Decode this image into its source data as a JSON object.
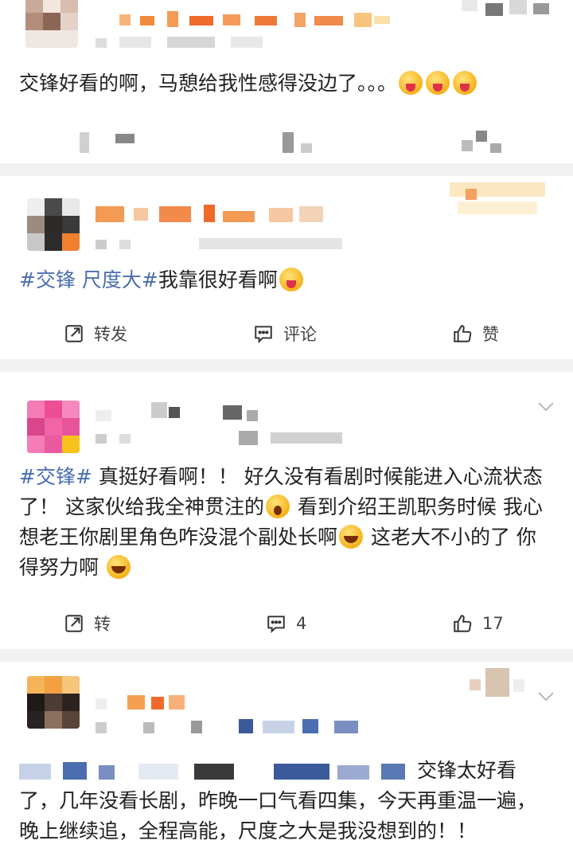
{
  "posts": [
    {
      "text_main": "交锋好看的啊，马憩给我性感得没边了。。。",
      "emojis": [
        "tongue-emoji",
        "tongue-emoji",
        "tongue-emoji"
      ]
    },
    {
      "topic": "#交锋 尺度大#",
      "text_main": "我靠很好看啊",
      "actions": {
        "repost": "转发",
        "comment": "评论",
        "like": "赞"
      }
    },
    {
      "topic": "#交锋#",
      "text_main": " 真挺好看啊！！ 好久没有看剧时候能进入心流状态了！ 这家伙给我全神贯注的",
      "text_mid": " 看到介绍王凯职务时候 我心想老王你剧里角色咋没混个副处长啊",
      "text_end": " 这老大不小的了 你得努力啊 ",
      "actions": {
        "repost": "转",
        "comment": "4",
        "like": "17"
      }
    },
    {
      "text_main": "交锋太好看了，几年没看长剧，昨晚一口气看四集，今天再重温一遍，晚上继续追，全程高能，尺度之大是我没想到的！！"
    }
  ],
  "colors": {
    "topic": "#4a6eb0",
    "separator": "#f1f1f1",
    "action_text": "#444444"
  }
}
